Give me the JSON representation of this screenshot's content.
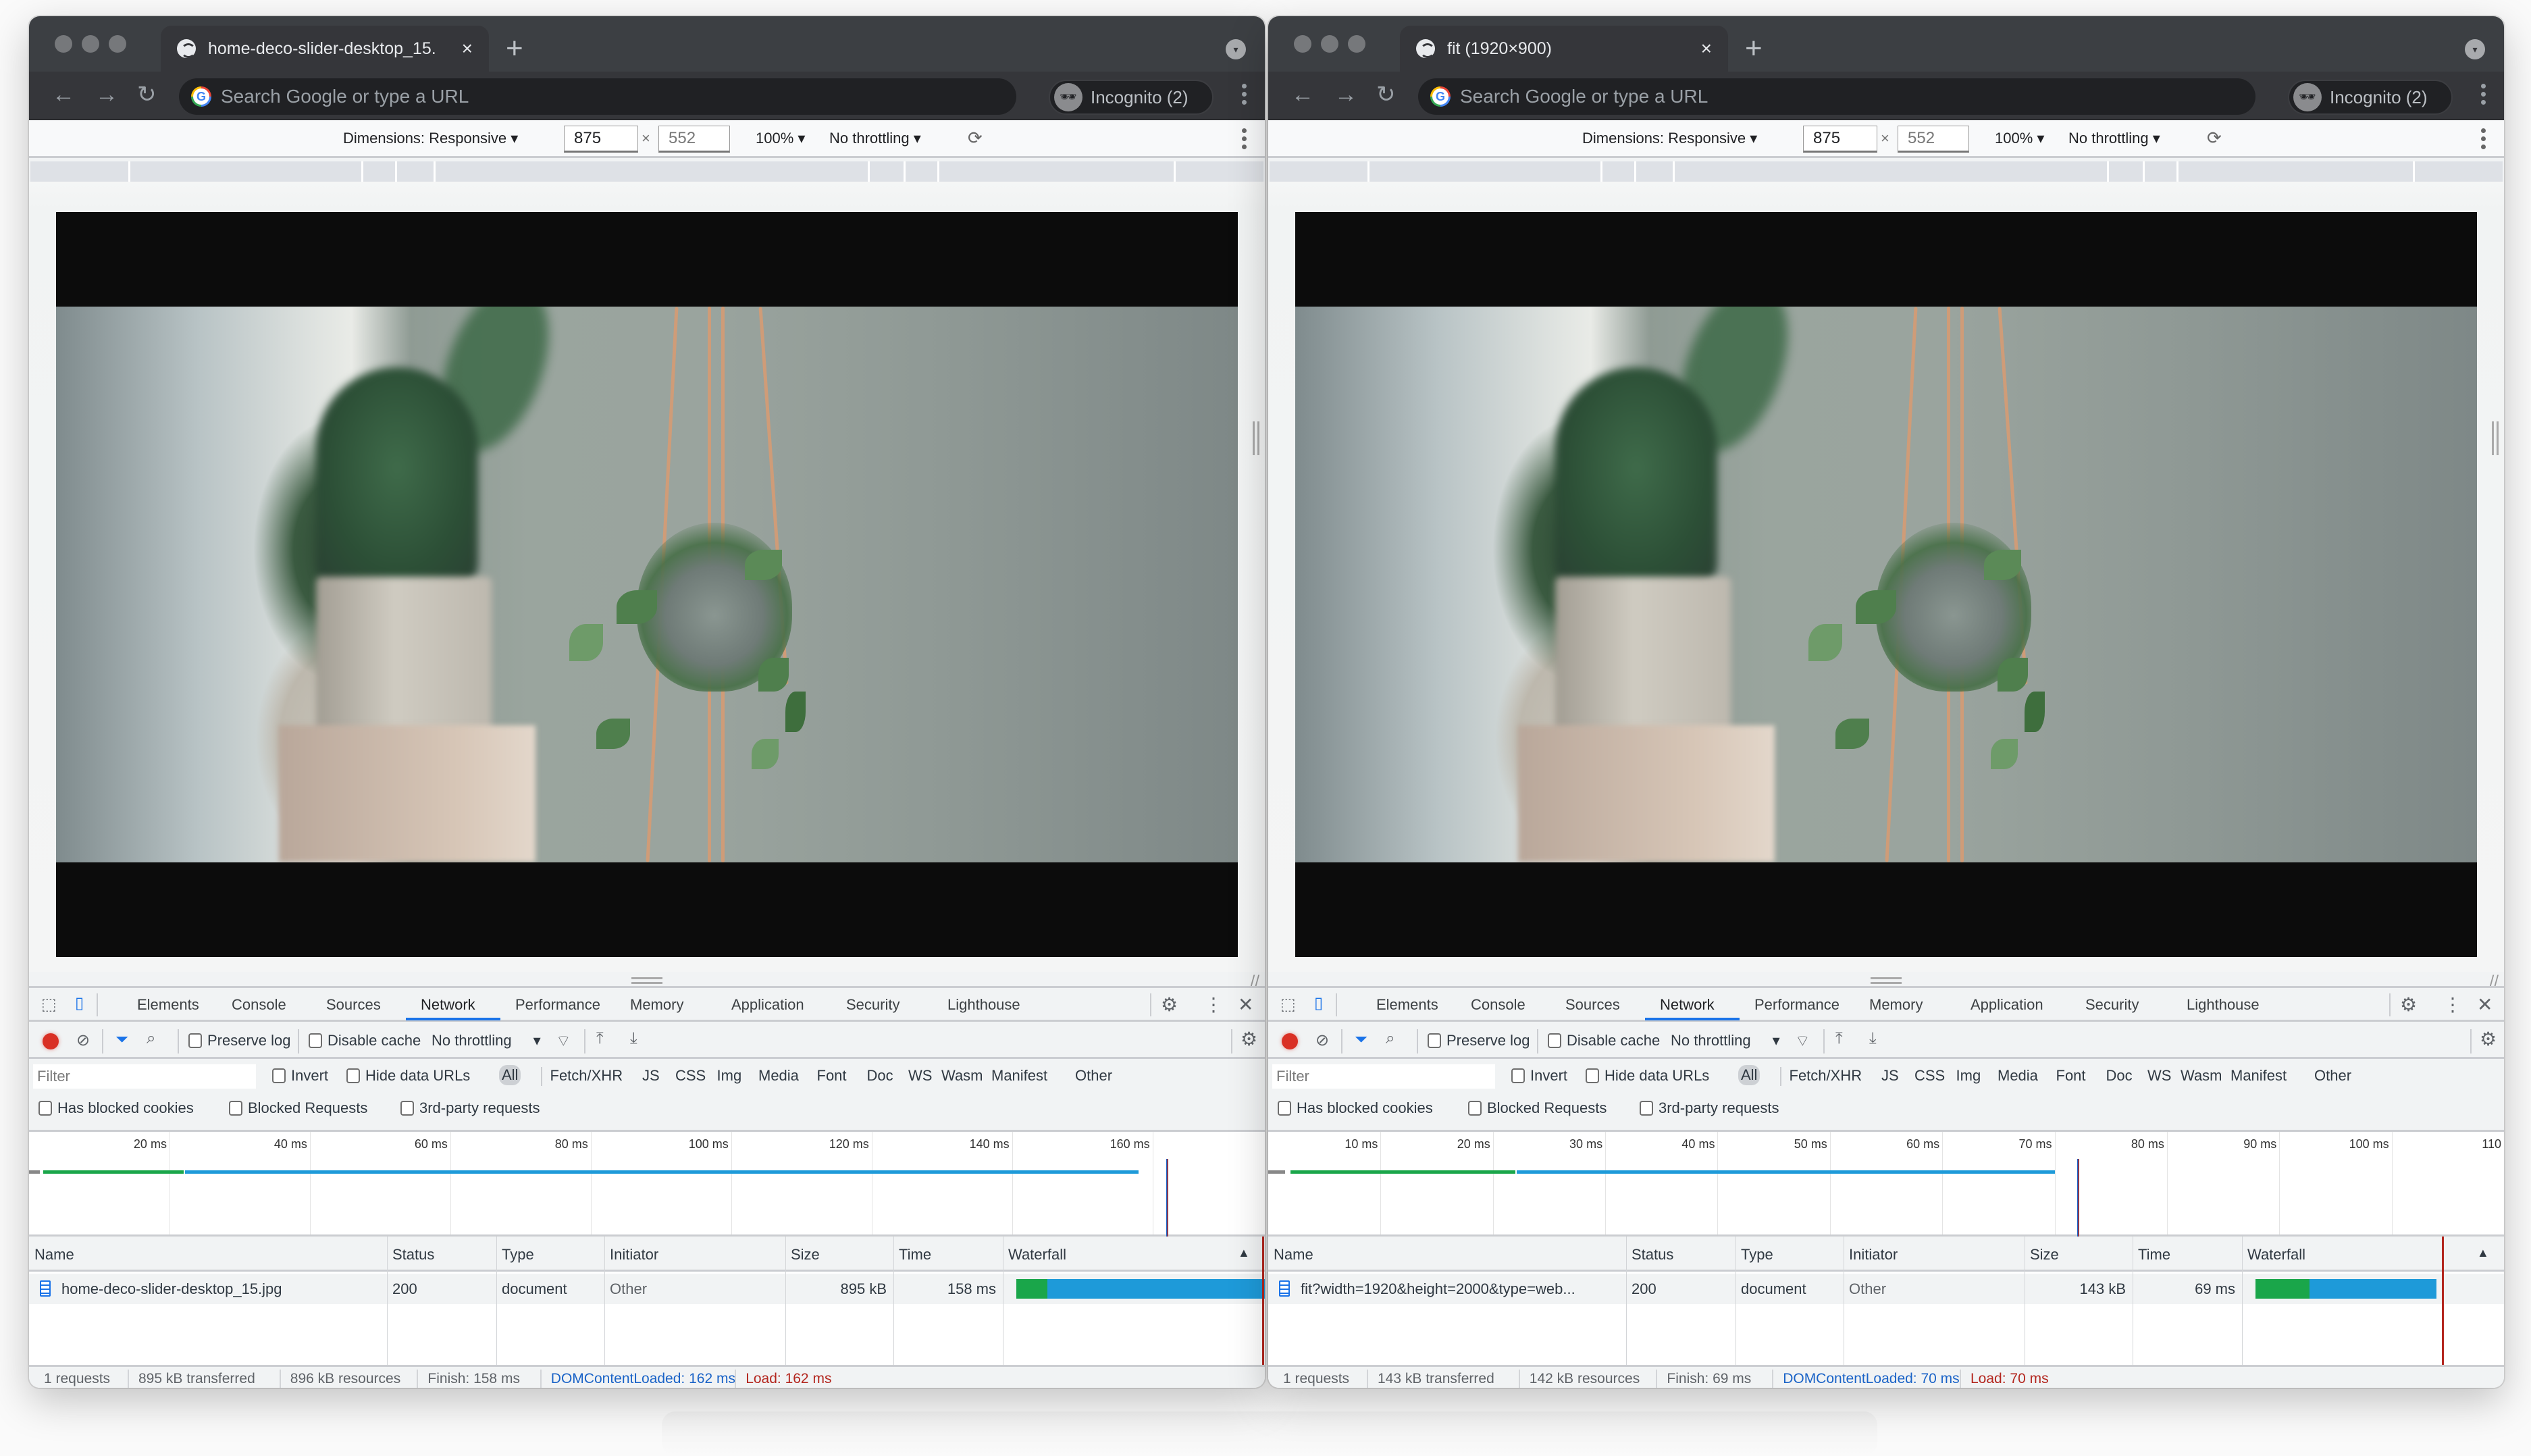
{
  "windows": [
    {
      "id": "left",
      "tab": {
        "title": "home-deco-slider-desktop_15.",
        "close": "×",
        "favicon": "globe-icon"
      },
      "new_tab": "+",
      "omnibox": {
        "placeholder": "Search Google or type a URL"
      },
      "incognito": {
        "label": "Incognito (2)"
      },
      "device_toolbar": {
        "dimensions": "Dimensions: Responsive ▾",
        "width": "875",
        "height": "552",
        "times": "×",
        "zoom": "100% ▾",
        "throttling": "No throttling ▾",
        "rotate_icon": "⟳"
      },
      "devtools": {
        "tabs": [
          "Elements",
          "Console",
          "Sources",
          "Network",
          "Performance",
          "Memory",
          "Application",
          "Security",
          "Lighthouse"
        ],
        "active_tab": "Network",
        "toolbar": {
          "preserve_log": "Preserve log",
          "disable_cache": "Disable cache",
          "throttling": "No throttling"
        },
        "filter": {
          "placeholder": "Filter",
          "invert": "Invert",
          "hide_data_urls": "Hide data URLs",
          "types": [
            "All",
            "Fetch/XHR",
            "JS",
            "CSS",
            "Img",
            "Media",
            "Font",
            "Doc",
            "WS",
            "Wasm",
            "Manifest",
            "Other"
          ],
          "active_type": "All"
        },
        "blocked": {
          "has_blocked_cookies": "Has blocked cookies",
          "blocked_requests": "Blocked Requests",
          "third_party": "3rd-party requests"
        },
        "overview": {
          "ticks": [
            "20 ms",
            "40 ms",
            "60 ms",
            "80 ms",
            "100 ms",
            "120 ms",
            "140 ms",
            "160 ms"
          ],
          "tick_values_ms": [
            20,
            40,
            60,
            80,
            100,
            120,
            140,
            160
          ],
          "range_ms": 176,
          "waiting_end_ms": 22,
          "download_end_ms": 158,
          "load_ms": 162
        },
        "table": {
          "columns": [
            "Name",
            "Status",
            "Type",
            "Initiator",
            "Size",
            "Time",
            "Waterfall"
          ],
          "rows": [
            {
              "name": "home-deco-slider-desktop_15.jpg",
              "status": "200",
              "type": "document",
              "initiator": "Other",
              "size": "895 kB",
              "time": "158 ms"
            }
          ],
          "sort_icon": "▲"
        },
        "status": {
          "requests": "1 requests",
          "transferred": "895 kB transferred",
          "resources": "896 kB resources",
          "finish": "Finish: 158 ms",
          "dom_content_loaded": "DOMContentLoaded: 162 ms",
          "load": "Load: 162 ms"
        }
      }
    },
    {
      "id": "right",
      "tab": {
        "title": "fit (1920×900)",
        "close": "×",
        "favicon": "globe-icon"
      },
      "new_tab": "+",
      "omnibox": {
        "placeholder": "Search Google or type a URL"
      },
      "incognito": {
        "label": "Incognito (2)"
      },
      "device_toolbar": {
        "dimensions": "Dimensions: Responsive ▾",
        "width": "875",
        "height": "552",
        "times": "×",
        "zoom": "100% ▾",
        "throttling": "No throttling ▾",
        "rotate_icon": "⟳"
      },
      "devtools": {
        "tabs": [
          "Elements",
          "Console",
          "Sources",
          "Network",
          "Performance",
          "Memory",
          "Application",
          "Security",
          "Lighthouse"
        ],
        "active_tab": "Network",
        "toolbar": {
          "preserve_log": "Preserve log",
          "disable_cache": "Disable cache",
          "throttling": "No throttling"
        },
        "filter": {
          "placeholder": "Filter",
          "invert": "Invert",
          "hide_data_urls": "Hide data URLs",
          "types": [
            "All",
            "Fetch/XHR",
            "JS",
            "CSS",
            "Img",
            "Media",
            "Font",
            "Doc",
            "WS",
            "Wasm",
            "Manifest",
            "Other"
          ],
          "active_type": "All"
        },
        "blocked": {
          "has_blocked_cookies": "Has blocked cookies",
          "blocked_requests": "Blocked Requests",
          "third_party": "3rd-party requests"
        },
        "overview": {
          "ticks": [
            "10 ms",
            "20 ms",
            "30 ms",
            "40 ms",
            "50 ms",
            "60 ms",
            "70 ms",
            "80 ms",
            "90 ms",
            "100 ms",
            "110"
          ],
          "tick_values_ms": [
            10,
            20,
            30,
            40,
            50,
            60,
            70,
            80,
            90,
            100,
            110
          ],
          "range_ms": 110,
          "waiting_end_ms": 22,
          "download_end_ms": 70,
          "load_ms": 72
        },
        "table": {
          "columns": [
            "Name",
            "Status",
            "Type",
            "Initiator",
            "Size",
            "Time",
            "Waterfall"
          ],
          "rows": [
            {
              "name": "fit?width=1920&height=2000&type=web...",
              "status": "200",
              "type": "document",
              "initiator": "Other",
              "size": "143 kB",
              "time": "69 ms"
            }
          ],
          "sort_icon": "▲"
        },
        "status": {
          "requests": "1 requests",
          "transferred": "143 kB transferred",
          "resources": "142 kB resources",
          "finish": "Finish: 69 ms",
          "dom_content_loaded": "DOMContentLoaded: 70 ms",
          "load": "Load: 70 ms"
        }
      }
    }
  ],
  "colors": {
    "waiting": "#1aa64a",
    "download": "#1e9ad9",
    "dom_content_loaded": "#1a63c7",
    "load": "#b3261e",
    "active_tab_underline": "#1a73e8",
    "record": "#d93025"
  }
}
